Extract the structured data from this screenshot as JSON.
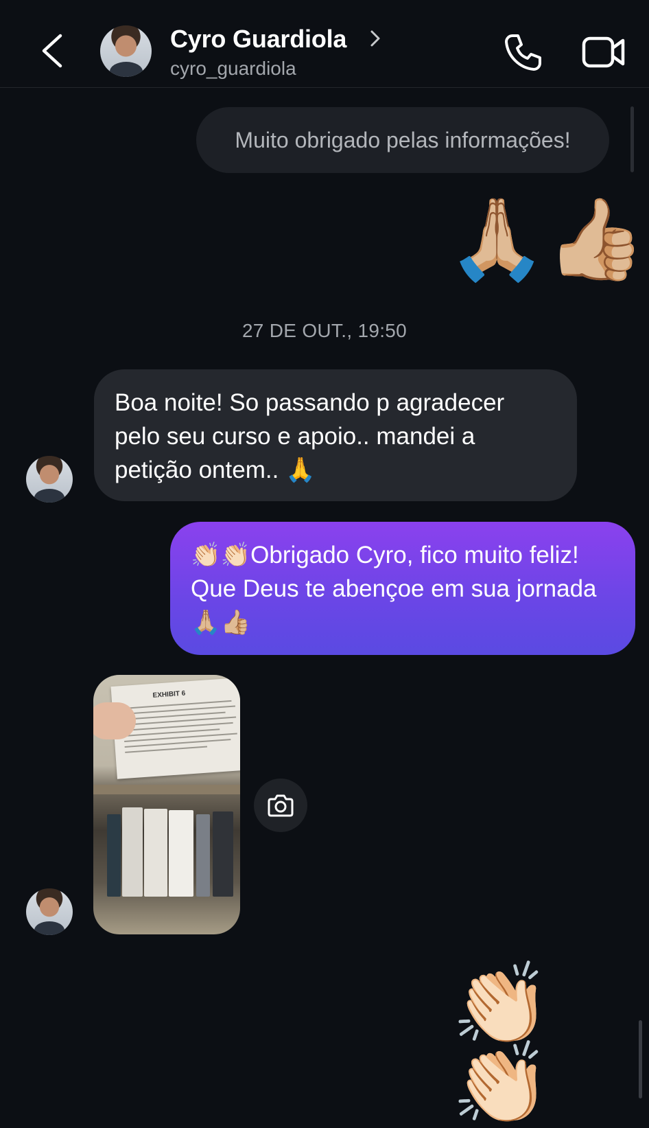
{
  "header": {
    "back_icon": "chevron-left-icon",
    "contact_name": "Cyro Guardiola",
    "contact_handle": "cyro_guardiola",
    "call_icon": "phone-icon",
    "video_icon": "video-camera-icon"
  },
  "messages": {
    "sent_text_1": "Muito obrigado pelas informações!",
    "sent_emoji_1": "🙏🏼👍🏼",
    "timestamp": "27 DE OUT., 19:50",
    "received_text_1": "Boa noite! So passando p agradecer pelo seu curso e apoio.. mandei a petição ontem.. 🙏",
    "sent_text_2": "👏🏻👏🏻Obrigado Cyro, fico muito feliz! Que Deus te abençoe em sua jornada 🙏🏼👍🏼",
    "received_photo_text": "EXHIBIT 6",
    "camera_icon": "camera-icon",
    "sent_emoji_2": "👏🏻👏🏻"
  },
  "colors": {
    "background": "#0c0f14",
    "received_bubble": "#25282e",
    "sent_bubble_top": "#8b41ee",
    "sent_bubble_bottom": "#5a4ae2"
  }
}
